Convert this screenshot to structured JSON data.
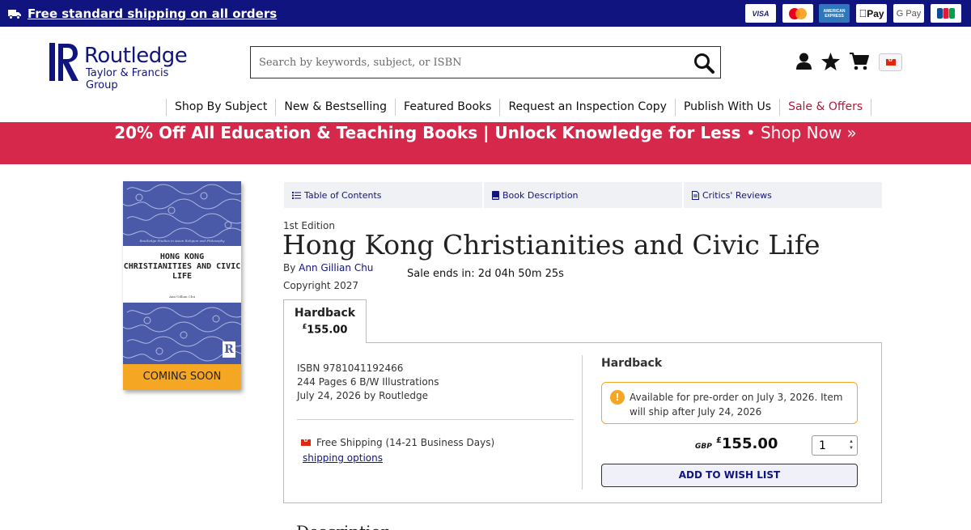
{
  "topbar": {
    "shipping_link": "Free standard shipping on all orders",
    "payment_methods": [
      "VISA",
      "Mastercard",
      "American Express",
      "Apple Pay",
      "Google Pay",
      "JCB"
    ],
    "payment_labels": {
      "visa": "VISA",
      "amex": "AMERICAN EXPRESS",
      "applepay": "Pay",
      "gpay": "G Pay",
      "jcb": "JCB"
    }
  },
  "header": {
    "logo_main": "Routledge",
    "logo_sub": "Taylor & Francis Group",
    "logo_spine": "ROUTLEDGE",
    "search_placeholder": "Search by keywords, subject, or ISBN",
    "icons": [
      "user-icon",
      "star-icon",
      "cart-icon",
      "flag-icon"
    ]
  },
  "nav": {
    "items": [
      "Shop By Subject",
      "New & Bestselling",
      "Featured Books",
      "Request an Inspection Copy",
      "Publish With Us",
      "Sale & Offers"
    ]
  },
  "promo": {
    "headline": "20% Off All Education & Teaching Books | Unlock Knowledge for Less",
    "bullet": "•",
    "cta": "Shop Now »",
    "timer": "Sale ends in: 2d 04h 50m 25s",
    "color": "#d6284a"
  },
  "cover": {
    "series": "Routledge Studies in Asian Religion and Philosophy",
    "title_lines": [
      "HONG KONG",
      "CHRISTIANITIES AND CIVIC",
      "LIFE"
    ],
    "author": "Ann Gillian Chu",
    "publisher_mark": "R",
    "badge": "COMING SOON"
  },
  "tabs": [
    {
      "label": "Table of Contents",
      "icon": "list-icon"
    },
    {
      "label": "Book Description",
      "icon": "book-icon"
    },
    {
      "label": "Critics' Reviews",
      "icon": "document-icon"
    }
  ],
  "book": {
    "edition": "1st Edition",
    "title": "Hong Kong Christianities and Civic Life",
    "by_label": "By",
    "author": "Ann Gillian Chu",
    "copyright": "Copyright 2027"
  },
  "format_tab": {
    "name": "Hardback",
    "currency_symbol": "£",
    "price": "155.00"
  },
  "details": {
    "isbn": "ISBN 9781041192466",
    "pages": "244 Pages 6 B/W Illustrations",
    "date": "July 24, 2026 by Routledge",
    "shipping": "Free Shipping (14-21 Business Days)",
    "shipping_options": "shipping options"
  },
  "purchase": {
    "heading": "Hardback",
    "notice": "Available for pre-order on July 3, 2026. Item will ship after July 24, 2026",
    "currency_code": "GBP",
    "currency_symbol": "£",
    "price": "155.00",
    "quantity": "1",
    "wishlist": "ADD TO WISH LIST"
  },
  "description_heading": "Description",
  "colors": {
    "navy": "#10147e",
    "promo_red": "#d6284a",
    "orange": "#f5a623",
    "sale_text": "#b0193a"
  }
}
